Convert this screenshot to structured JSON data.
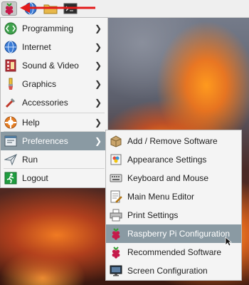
{
  "panel": {
    "launcher_icon": "raspberry-pi-icon",
    "quick_launch": [
      "web-browser-icon",
      "file-manager-icon",
      "terminal-icon"
    ],
    "annotation_color": "#e31b1b"
  },
  "main_menu": {
    "items": [
      {
        "label": "Programming",
        "icon": "programming-icon"
      },
      {
        "label": "Internet",
        "icon": "internet-icon"
      },
      {
        "label": "Sound & Video",
        "icon": "sound-video-icon"
      },
      {
        "label": "Graphics",
        "icon": "graphics-icon"
      },
      {
        "label": "Accessories",
        "icon": "accessories-icon"
      },
      {
        "label": "Help",
        "icon": "help-icon"
      },
      {
        "label": "Preferences",
        "icon": "preferences-icon",
        "selected": true
      },
      {
        "label": "Run",
        "icon": "run-icon"
      },
      {
        "label": "Logout",
        "icon": "logout-icon"
      }
    ]
  },
  "preferences_menu": {
    "items": [
      {
        "label": "Add / Remove Software",
        "icon": "add-remove-software-icon"
      },
      {
        "label": "Appearance Settings",
        "icon": "appearance-settings-icon"
      },
      {
        "label": "Keyboard and Mouse",
        "icon": "keyboard-mouse-icon"
      },
      {
        "label": "Main Menu Editor",
        "icon": "menu-editor-icon"
      },
      {
        "label": "Print Settings",
        "icon": "printer-icon"
      },
      {
        "label": "Raspberry Pi Configuration",
        "icon": "raspberry-pi-icon",
        "selected": true
      },
      {
        "label": "Recommended Software",
        "icon": "raspberry-pi-icon"
      },
      {
        "label": "Screen Configuration",
        "icon": "monitor-icon"
      }
    ]
  },
  "colors": {
    "selection": "#8a9aa3",
    "menu_bg": "#f4f4f4"
  }
}
